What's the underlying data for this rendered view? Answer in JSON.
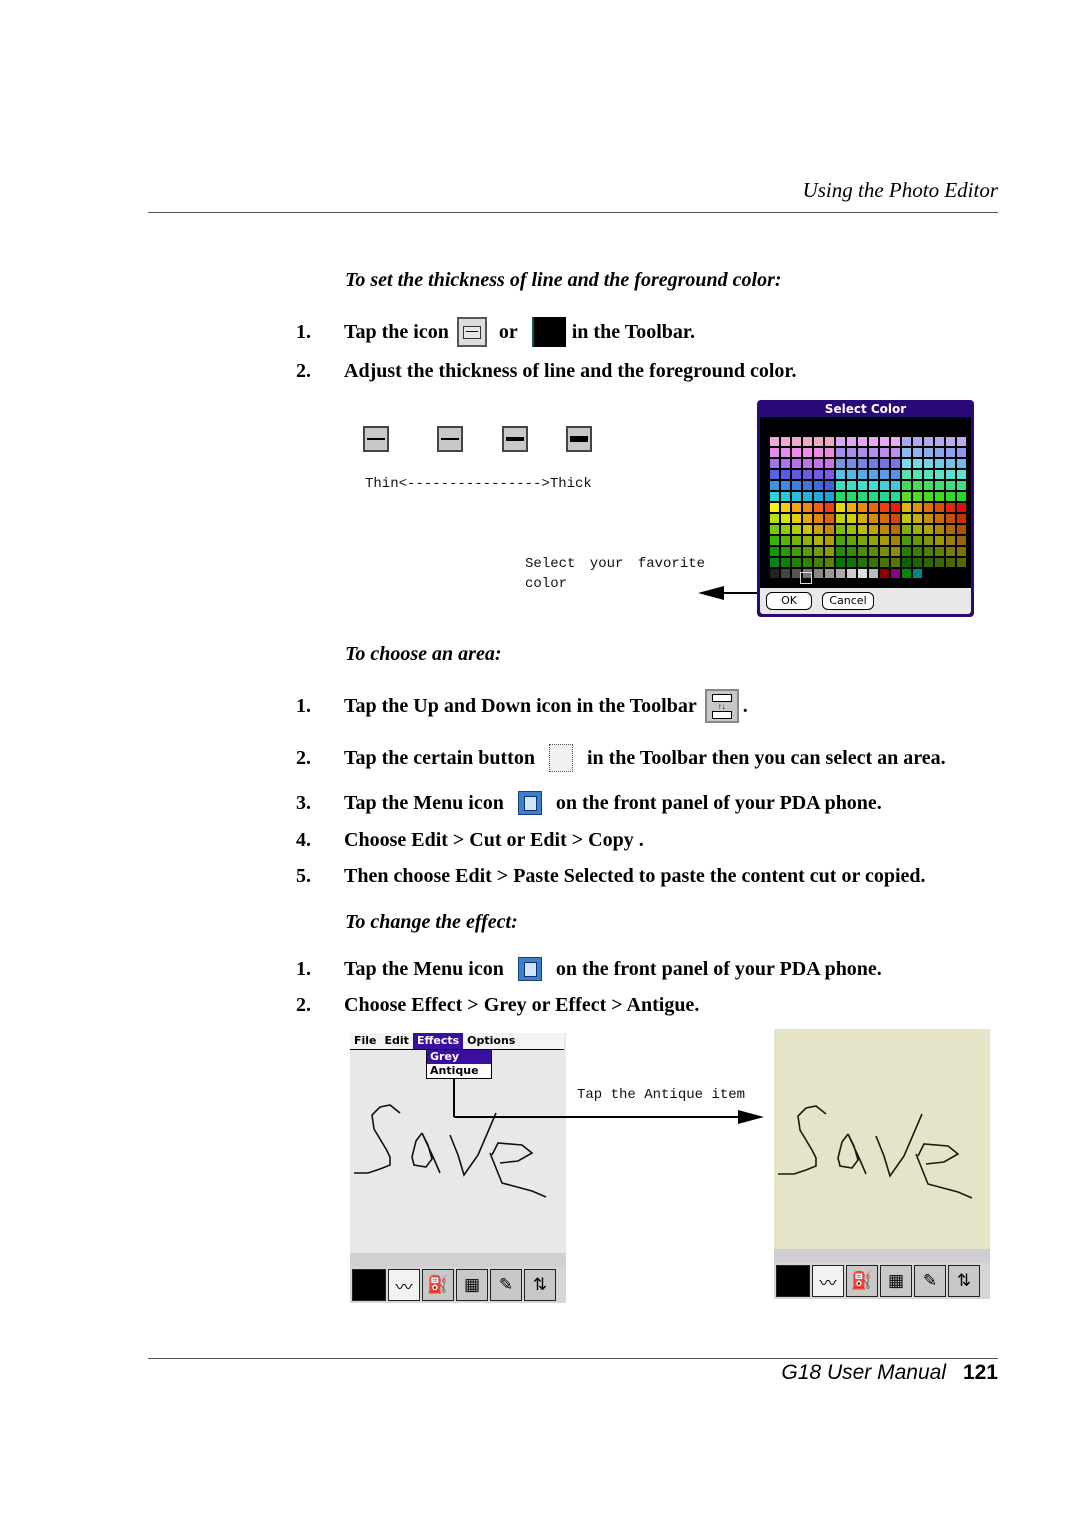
{
  "header": {
    "title": "Using the Photo Editor"
  },
  "section1": {
    "title": "To set the thickness of line and the foreground color:",
    "steps": [
      {
        "num": "1.",
        "pre": "Tap the icon",
        "mid": "or",
        "post": "in the Toolbar.",
        "icons": [
          "line-thickness-icon",
          "foreground-color-icon"
        ]
      },
      {
        "num": "2.",
        "text": "Adjust the thickness of line and the foreground color."
      }
    ],
    "thickness_scale_label": "Thin<---------------->Thick",
    "thickness_levels": [
      "thin",
      "medium",
      "thick",
      "thickest"
    ],
    "callout": "Select  your  favorite color",
    "callout_line1": "Select  your  favorite",
    "callout_line2": "color",
    "dialog": {
      "title": "Select Color",
      "ok_label": "OK",
      "cancel_label": "Cancel"
    }
  },
  "section2": {
    "title": "To choose an area:",
    "steps": [
      {
        "num": "1.",
        "pre": "Tap the Up and Down icon in the Toolbar",
        "post": "."
      },
      {
        "num": "2.",
        "pre": "Tap the certain button",
        "post": "in the Toolbar then you can select an area."
      },
      {
        "num": "3.",
        "pre": "Tap the Menu icon",
        "post": "on the front panel of your PDA phone."
      },
      {
        "num": "4.",
        "text": "Choose Edit > Cut or Edit > Copy ."
      },
      {
        "num": "5.",
        "text": "Then choose Edit > Paste Selected to paste the content cut or copied."
      }
    ]
  },
  "section3": {
    "title": "To change the effect:",
    "steps": [
      {
        "num": "1.",
        "pre": "Tap the Menu icon",
        "post": "on the front panel of your PDA phone."
      },
      {
        "num": "2.",
        "text": "Choose Effect > Grey or Effect > Antigue."
      }
    ],
    "callout": "Tap the Antique item",
    "pda_before": {
      "menu": [
        "File",
        "Edit",
        "Effects",
        "Options"
      ],
      "active_menu": "Effects",
      "dropdown": [
        "Grey",
        "Antique"
      ],
      "selected_item": "Grey",
      "canvas_color": "#e8e8e8",
      "drawing_text": "Save"
    },
    "pda_after": {
      "canvas_color": "#e6e4c6",
      "drawing_text": "Save"
    },
    "toolbar_icons": [
      "color-swatch-icon",
      "pen-line-icon",
      "stamp-icon",
      "picture-icon",
      "pen-brush-icon",
      "up-down-icon"
    ]
  },
  "footer": {
    "manual": "G18 User Manual",
    "page": "121"
  },
  "colors": {
    "dialog_frame": "#2a0a78",
    "menu_highlight": "#3a0fa0",
    "antique_bg": "#e6e4c6"
  }
}
